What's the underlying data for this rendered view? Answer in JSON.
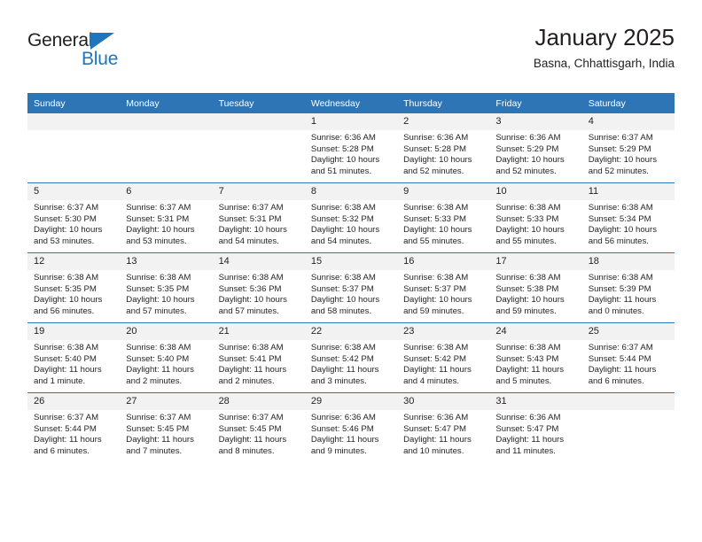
{
  "brand": {
    "line1": "General",
    "line2": "Blue",
    "triangle_icon": "triangle-icon"
  },
  "header": {
    "title": "January 2025",
    "subtitle": "Basna, Chhattisgarh, India"
  },
  "colors": {
    "header_blue": "#2e75b6",
    "brand_blue": "#1f76bc",
    "daynum_bg": "#f2f2f2",
    "text": "#231f20"
  },
  "weekday_headers": [
    "Sunday",
    "Monday",
    "Tuesday",
    "Wednesday",
    "Thursday",
    "Friday",
    "Saturday"
  ],
  "weeks": [
    [
      {
        "day": "",
        "sunrise": "",
        "sunset": "",
        "daylight": ""
      },
      {
        "day": "",
        "sunrise": "",
        "sunset": "",
        "daylight": ""
      },
      {
        "day": "",
        "sunrise": "",
        "sunset": "",
        "daylight": ""
      },
      {
        "day": "1",
        "sunrise": "Sunrise: 6:36 AM",
        "sunset": "Sunset: 5:28 PM",
        "daylight": "Daylight: 10 hours and 51 minutes."
      },
      {
        "day": "2",
        "sunrise": "Sunrise: 6:36 AM",
        "sunset": "Sunset: 5:28 PM",
        "daylight": "Daylight: 10 hours and 52 minutes."
      },
      {
        "day": "3",
        "sunrise": "Sunrise: 6:36 AM",
        "sunset": "Sunset: 5:29 PM",
        "daylight": "Daylight: 10 hours and 52 minutes."
      },
      {
        "day": "4",
        "sunrise": "Sunrise: 6:37 AM",
        "sunset": "Sunset: 5:29 PM",
        "daylight": "Daylight: 10 hours and 52 minutes."
      }
    ],
    [
      {
        "day": "5",
        "sunrise": "Sunrise: 6:37 AM",
        "sunset": "Sunset: 5:30 PM",
        "daylight": "Daylight: 10 hours and 53 minutes."
      },
      {
        "day": "6",
        "sunrise": "Sunrise: 6:37 AM",
        "sunset": "Sunset: 5:31 PM",
        "daylight": "Daylight: 10 hours and 53 minutes."
      },
      {
        "day": "7",
        "sunrise": "Sunrise: 6:37 AM",
        "sunset": "Sunset: 5:31 PM",
        "daylight": "Daylight: 10 hours and 54 minutes."
      },
      {
        "day": "8",
        "sunrise": "Sunrise: 6:38 AM",
        "sunset": "Sunset: 5:32 PM",
        "daylight": "Daylight: 10 hours and 54 minutes."
      },
      {
        "day": "9",
        "sunrise": "Sunrise: 6:38 AM",
        "sunset": "Sunset: 5:33 PM",
        "daylight": "Daylight: 10 hours and 55 minutes."
      },
      {
        "day": "10",
        "sunrise": "Sunrise: 6:38 AM",
        "sunset": "Sunset: 5:33 PM",
        "daylight": "Daylight: 10 hours and 55 minutes."
      },
      {
        "day": "11",
        "sunrise": "Sunrise: 6:38 AM",
        "sunset": "Sunset: 5:34 PM",
        "daylight": "Daylight: 10 hours and 56 minutes."
      }
    ],
    [
      {
        "day": "12",
        "sunrise": "Sunrise: 6:38 AM",
        "sunset": "Sunset: 5:35 PM",
        "daylight": "Daylight: 10 hours and 56 minutes."
      },
      {
        "day": "13",
        "sunrise": "Sunrise: 6:38 AM",
        "sunset": "Sunset: 5:35 PM",
        "daylight": "Daylight: 10 hours and 57 minutes."
      },
      {
        "day": "14",
        "sunrise": "Sunrise: 6:38 AM",
        "sunset": "Sunset: 5:36 PM",
        "daylight": "Daylight: 10 hours and 57 minutes."
      },
      {
        "day": "15",
        "sunrise": "Sunrise: 6:38 AM",
        "sunset": "Sunset: 5:37 PM",
        "daylight": "Daylight: 10 hours and 58 minutes."
      },
      {
        "day": "16",
        "sunrise": "Sunrise: 6:38 AM",
        "sunset": "Sunset: 5:37 PM",
        "daylight": "Daylight: 10 hours and 59 minutes."
      },
      {
        "day": "17",
        "sunrise": "Sunrise: 6:38 AM",
        "sunset": "Sunset: 5:38 PM",
        "daylight": "Daylight: 10 hours and 59 minutes."
      },
      {
        "day": "18",
        "sunrise": "Sunrise: 6:38 AM",
        "sunset": "Sunset: 5:39 PM",
        "daylight": "Daylight: 11 hours and 0 minutes."
      }
    ],
    [
      {
        "day": "19",
        "sunrise": "Sunrise: 6:38 AM",
        "sunset": "Sunset: 5:40 PM",
        "daylight": "Daylight: 11 hours and 1 minute."
      },
      {
        "day": "20",
        "sunrise": "Sunrise: 6:38 AM",
        "sunset": "Sunset: 5:40 PM",
        "daylight": "Daylight: 11 hours and 2 minutes."
      },
      {
        "day": "21",
        "sunrise": "Sunrise: 6:38 AM",
        "sunset": "Sunset: 5:41 PM",
        "daylight": "Daylight: 11 hours and 2 minutes."
      },
      {
        "day": "22",
        "sunrise": "Sunrise: 6:38 AM",
        "sunset": "Sunset: 5:42 PM",
        "daylight": "Daylight: 11 hours and 3 minutes."
      },
      {
        "day": "23",
        "sunrise": "Sunrise: 6:38 AM",
        "sunset": "Sunset: 5:42 PM",
        "daylight": "Daylight: 11 hours and 4 minutes."
      },
      {
        "day": "24",
        "sunrise": "Sunrise: 6:38 AM",
        "sunset": "Sunset: 5:43 PM",
        "daylight": "Daylight: 11 hours and 5 minutes."
      },
      {
        "day": "25",
        "sunrise": "Sunrise: 6:37 AM",
        "sunset": "Sunset: 5:44 PM",
        "daylight": "Daylight: 11 hours and 6 minutes."
      }
    ],
    [
      {
        "day": "26",
        "sunrise": "Sunrise: 6:37 AM",
        "sunset": "Sunset: 5:44 PM",
        "daylight": "Daylight: 11 hours and 6 minutes."
      },
      {
        "day": "27",
        "sunrise": "Sunrise: 6:37 AM",
        "sunset": "Sunset: 5:45 PM",
        "daylight": "Daylight: 11 hours and 7 minutes."
      },
      {
        "day": "28",
        "sunrise": "Sunrise: 6:37 AM",
        "sunset": "Sunset: 5:45 PM",
        "daylight": "Daylight: 11 hours and 8 minutes."
      },
      {
        "day": "29",
        "sunrise": "Sunrise: 6:36 AM",
        "sunset": "Sunset: 5:46 PM",
        "daylight": "Daylight: 11 hours and 9 minutes."
      },
      {
        "day": "30",
        "sunrise": "Sunrise: 6:36 AM",
        "sunset": "Sunset: 5:47 PM",
        "daylight": "Daylight: 11 hours and 10 minutes."
      },
      {
        "day": "31",
        "sunrise": "Sunrise: 6:36 AM",
        "sunset": "Sunset: 5:47 PM",
        "daylight": "Daylight: 11 hours and 11 minutes."
      },
      {
        "day": "",
        "sunrise": "",
        "sunset": "",
        "daylight": ""
      }
    ]
  ]
}
